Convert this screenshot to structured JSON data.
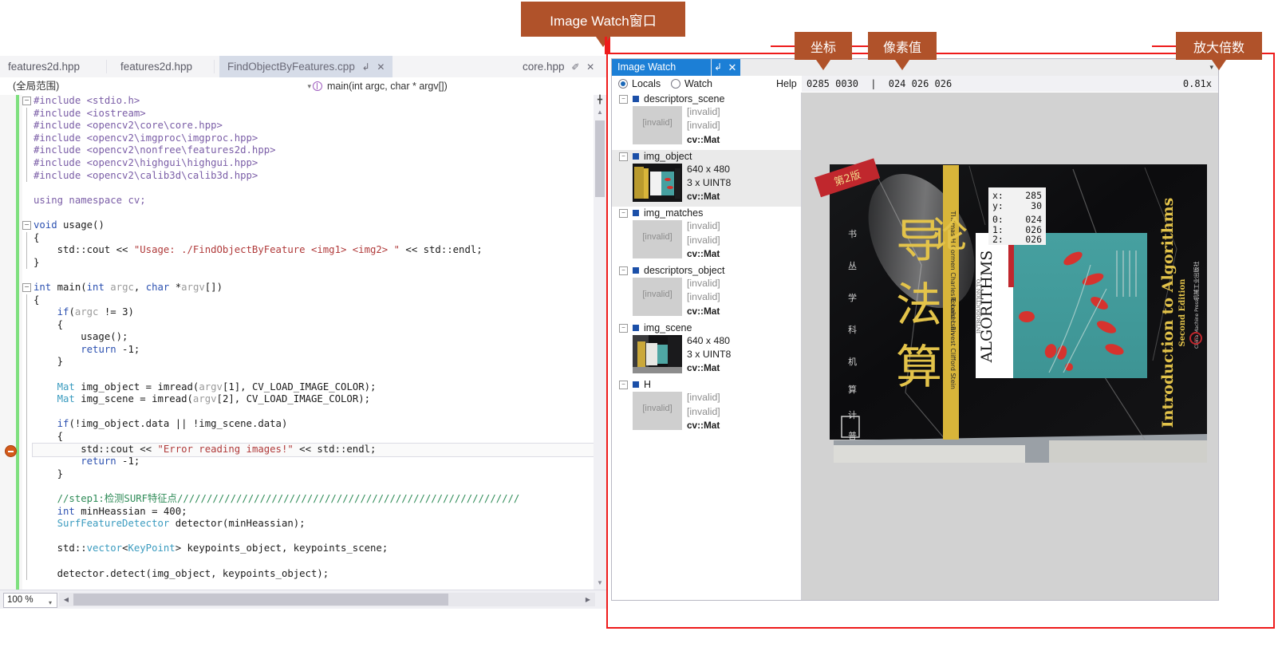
{
  "ide": {
    "tabs": [
      {
        "label": "features2d.hpp",
        "active": false,
        "pin": false,
        "close": false
      },
      {
        "label": "features2d.hpp",
        "active": false,
        "pin": false,
        "close": false
      },
      {
        "label": "FindObjectByFeatures.cpp",
        "active": true,
        "pin": "↲",
        "close": "✕"
      },
      {
        "label": "core.hpp",
        "active": false,
        "pin": "✐",
        "close": "✕"
      }
    ],
    "navbar": {
      "scope": "(全局范围)",
      "member": "main(int argc, char * argv[])",
      "caret": "▾"
    },
    "status": {
      "zoom": "100 %",
      "caret": "▾",
      "left_arrow": "◀",
      "right_arrow": "▶"
    },
    "code_lines": [
      {
        "fold": "−",
        "bar": false,
        "tokens": [
          {
            "t": "#include ",
            "c": "pre"
          },
          {
            "t": "<stdio.h>",
            "c": "pre"
          }
        ]
      },
      {
        "fold": "",
        "bar": true,
        "tokens": [
          {
            "t": "#include ",
            "c": "pre"
          },
          {
            "t": "<iostream>",
            "c": "pre"
          }
        ]
      },
      {
        "fold": "",
        "bar": true,
        "tokens": [
          {
            "t": "#include ",
            "c": "pre"
          },
          {
            "t": "<opencv2\\core\\core.hpp>",
            "c": "pre"
          }
        ]
      },
      {
        "fold": "",
        "bar": true,
        "tokens": [
          {
            "t": "#include ",
            "c": "pre"
          },
          {
            "t": "<opencv2\\imgproc\\imgproc.hpp>",
            "c": "pre"
          }
        ]
      },
      {
        "fold": "",
        "bar": true,
        "tokens": [
          {
            "t": "#include ",
            "c": "pre"
          },
          {
            "t": "<opencv2\\nonfree\\features2d.hpp>",
            "c": "pre"
          }
        ]
      },
      {
        "fold": "",
        "bar": true,
        "tokens": [
          {
            "t": "#include ",
            "c": "pre"
          },
          {
            "t": "<opencv2\\highgui\\highgui.hpp>",
            "c": "pre"
          }
        ]
      },
      {
        "fold": "",
        "bar": true,
        "tokens": [
          {
            "t": "#include ",
            "c": "pre"
          },
          {
            "t": "<opencv2\\calib3d\\calib3d.hpp>",
            "c": "pre"
          }
        ]
      },
      {
        "fold": "",
        "bar": false,
        "tokens": []
      },
      {
        "fold": "",
        "bar": false,
        "tokens": [
          {
            "t": "using namespace cv;",
            "c": "pre"
          }
        ]
      },
      {
        "fold": "",
        "bar": false,
        "tokens": []
      },
      {
        "fold": "−",
        "bar": false,
        "tokens": [
          {
            "t": "void",
            "c": "kw"
          },
          {
            "t": " usage()",
            "c": "blk"
          }
        ]
      },
      {
        "fold": "",
        "bar": true,
        "tokens": [
          {
            "t": "{",
            "c": "blk"
          }
        ]
      },
      {
        "fold": "",
        "bar": true,
        "tokens": [
          {
            "t": "    std::cout << ",
            "c": "blk"
          },
          {
            "t": "\"Usage: ./FindObjectByFeature <img1> <img2> \"",
            "c": "str"
          },
          {
            "t": " << std::endl;",
            "c": "blk"
          }
        ]
      },
      {
        "fold": "",
        "bar": true,
        "tokens": [
          {
            "t": "}",
            "c": "blk"
          }
        ]
      },
      {
        "fold": "",
        "bar": false,
        "tokens": []
      },
      {
        "fold": "−",
        "bar": false,
        "tokens": [
          {
            "t": "int",
            "c": "kw"
          },
          {
            "t": " main(",
            "c": "blk"
          },
          {
            "t": "int",
            "c": "kw"
          },
          {
            "t": " ",
            "c": "blk"
          },
          {
            "t": "argc",
            "c": "gray"
          },
          {
            "t": ", ",
            "c": "blk"
          },
          {
            "t": "char",
            "c": "kw"
          },
          {
            "t": " *",
            "c": "blk"
          },
          {
            "t": "argv",
            "c": "gray"
          },
          {
            "t": "[])",
            "c": "blk"
          }
        ]
      },
      {
        "fold": "",
        "bar": true,
        "tokens": [
          {
            "t": "{",
            "c": "blk"
          }
        ]
      },
      {
        "fold": "",
        "bar": true,
        "tokens": [
          {
            "t": "    ",
            "c": "blk"
          },
          {
            "t": "if",
            "c": "kw"
          },
          {
            "t": "(",
            "c": "blk"
          },
          {
            "t": "argc",
            "c": "gray"
          },
          {
            "t": " != 3)",
            "c": "blk"
          }
        ]
      },
      {
        "fold": "",
        "bar": true,
        "tokens": [
          {
            "t": "    {",
            "c": "blk"
          }
        ]
      },
      {
        "fold": "",
        "bar": true,
        "tokens": [
          {
            "t": "        usage();",
            "c": "blk"
          }
        ]
      },
      {
        "fold": "",
        "bar": true,
        "tokens": [
          {
            "t": "        ",
            "c": "blk"
          },
          {
            "t": "return",
            "c": "kw"
          },
          {
            "t": " -1;",
            "c": "blk"
          }
        ]
      },
      {
        "fold": "",
        "bar": true,
        "tokens": [
          {
            "t": "    }",
            "c": "blk"
          }
        ]
      },
      {
        "fold": "",
        "bar": true,
        "tokens": []
      },
      {
        "fold": "",
        "bar": true,
        "tokens": [
          {
            "t": "    ",
            "c": "blk"
          },
          {
            "t": "Mat",
            "c": "typ"
          },
          {
            "t": " img_object = imread(",
            "c": "blk"
          },
          {
            "t": "argv",
            "c": "gray"
          },
          {
            "t": "[1], ",
            "c": "blk"
          },
          {
            "t": "CV_LOAD_IMAGE_COLOR",
            "c": "blk"
          },
          {
            "t": ");",
            "c": "blk"
          }
        ]
      },
      {
        "fold": "",
        "bar": true,
        "tokens": [
          {
            "t": "    ",
            "c": "blk"
          },
          {
            "t": "Mat",
            "c": "typ"
          },
          {
            "t": " img_scene = imread(",
            "c": "blk"
          },
          {
            "t": "argv",
            "c": "gray"
          },
          {
            "t": "[2], ",
            "c": "blk"
          },
          {
            "t": "CV_LOAD_IMAGE_COLOR",
            "c": "blk"
          },
          {
            "t": ");",
            "c": "blk"
          }
        ]
      },
      {
        "fold": "",
        "bar": true,
        "tokens": []
      },
      {
        "fold": "",
        "bar": true,
        "tokens": [
          {
            "t": "    ",
            "c": "blk"
          },
          {
            "t": "if",
            "c": "kw"
          },
          {
            "t": "(!img_object.data || !img_scene.data)",
            "c": "blk"
          }
        ]
      },
      {
        "fold": "",
        "bar": true,
        "tokens": [
          {
            "t": "    {",
            "c": "blk"
          }
        ]
      },
      {
        "fold": "",
        "bar": true,
        "tokens": [
          {
            "t": "        std::cout << ",
            "c": "blk"
          },
          {
            "t": "\"Error reading images!\"",
            "c": "str"
          },
          {
            "t": " << std::endl;",
            "c": "blk"
          }
        ]
      },
      {
        "fold": "",
        "bar": true,
        "tokens": [
          {
            "t": "        ",
            "c": "blk"
          },
          {
            "t": "return",
            "c": "kw"
          },
          {
            "t": " -1;",
            "c": "blk"
          }
        ]
      },
      {
        "fold": "",
        "bar": true,
        "tokens": [
          {
            "t": "    }",
            "c": "blk"
          }
        ]
      },
      {
        "fold": "",
        "bar": true,
        "tokens": []
      },
      {
        "fold": "",
        "bar": true,
        "tokens": [
          {
            "t": "    //step1:检测SURF特征点//////////////////////////////////////////////////////////",
            "c": "cmt"
          }
        ]
      },
      {
        "fold": "",
        "bar": true,
        "tokens": [
          {
            "t": "    ",
            "c": "blk"
          },
          {
            "t": "int",
            "c": "kw"
          },
          {
            "t": " minHeassian = 400;",
            "c": "blk"
          }
        ]
      },
      {
        "fold": "",
        "bar": true,
        "tokens": [
          {
            "t": "    ",
            "c": "blk"
          },
          {
            "t": "SurfFeatureDetector",
            "c": "typ"
          },
          {
            "t": " detector(minHeassian);",
            "c": "blk"
          }
        ]
      },
      {
        "fold": "",
        "bar": true,
        "tokens": []
      },
      {
        "fold": "",
        "bar": true,
        "tokens": [
          {
            "t": "    std::",
            "c": "blk"
          },
          {
            "t": "vector",
            "c": "typ"
          },
          {
            "t": "<",
            "c": "blk"
          },
          {
            "t": "KeyPoint",
            "c": "typ"
          },
          {
            "t": "> keypoints_object, keypoints_scene;",
            "c": "blk"
          }
        ]
      },
      {
        "fold": "",
        "bar": true,
        "tokens": []
      },
      {
        "fold": "",
        "bar": true,
        "tokens": [
          {
            "t": "    detector.detect(img_object, keypoints_object);",
            "c": "blk"
          }
        ]
      }
    ]
  },
  "image_watch": {
    "title": "Image Watch",
    "pin_icon": "↲",
    "close_icon": "✕",
    "menu_caret": "▾",
    "locals_label": "Locals",
    "watch_label": "Watch",
    "help_label": "Help",
    "locals_selected": true,
    "readout_coords": "0285 0030",
    "readout_sep": "|",
    "readout_pixel": "024 026 026",
    "zoom_level": "0.81x",
    "variables": [
      {
        "name": "descriptors_scene",
        "expander": "−",
        "valid": false,
        "thumb_text": "[invalid]",
        "dims": "[invalid]",
        "depth": "[invalid]",
        "type": "cv::Mat",
        "selected": false
      },
      {
        "name": "img_object",
        "expander": "−",
        "valid": true,
        "thumb_text": "",
        "dims": "640 x 480",
        "depth": "3 x UINT8",
        "type": "cv::Mat",
        "selected": true
      },
      {
        "name": "img_matches",
        "expander": "−",
        "valid": false,
        "thumb_text": "[invalid]",
        "dims": "[invalid]",
        "depth": "[invalid]",
        "type": "cv::Mat",
        "selected": false
      },
      {
        "name": "descriptors_object",
        "expander": "−",
        "valid": false,
        "thumb_text": "[invalid]",
        "dims": "[invalid]",
        "depth": "[invalid]",
        "type": "cv::Mat",
        "selected": false
      },
      {
        "name": "img_scene",
        "expander": "−",
        "valid": true,
        "thumb_text": "",
        "dims": "640 x 480",
        "depth": "3 x UINT8",
        "type": "cv::Mat",
        "selected": false
      },
      {
        "name": "H",
        "expander": "−",
        "valid": false,
        "thumb_text": "[invalid]",
        "dims": "[invalid]",
        "depth": "[invalid]",
        "type": "cv::Mat",
        "selected": false
      }
    ],
    "pixel_tooltip": {
      "rows": [
        {
          "k": "x:",
          "v": "285"
        },
        {
          "k": "y:",
          "v": "30"
        },
        {
          "k": "0:",
          "v": "024"
        },
        {
          "k": "1:",
          "v": "026"
        },
        {
          "k": "2:",
          "v": "026"
        }
      ]
    },
    "viewer_image_alt": "算法导论 / Introduction to Algorithms Second Edition book cover"
  },
  "annotations": {
    "accent_color": "#b0522a",
    "highlight_color": "#ee1b1b",
    "callouts": [
      {
        "id": "window",
        "label": "Image Watch窗口"
      },
      {
        "id": "coords",
        "label": "坐标"
      },
      {
        "id": "pixel",
        "label": "像素值"
      },
      {
        "id": "zoom",
        "label": "放大倍数"
      }
    ]
  }
}
